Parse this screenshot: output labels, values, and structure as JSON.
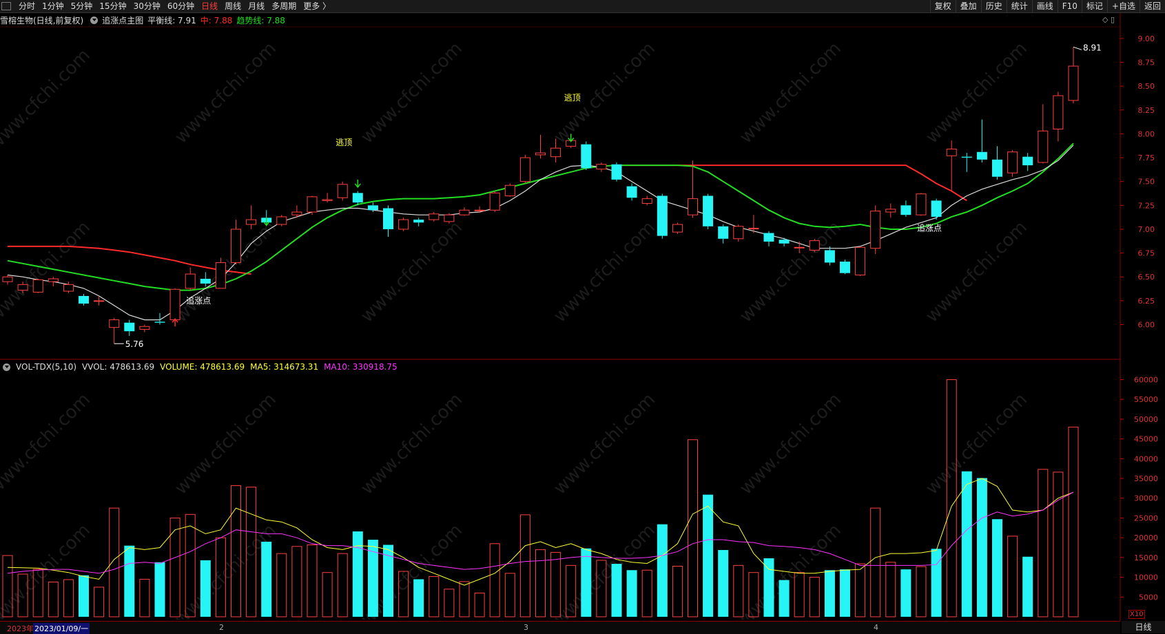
{
  "toolbar": {
    "timeframes": [
      {
        "label": "分时",
        "active": false
      },
      {
        "label": "1分钟",
        "active": false
      },
      {
        "label": "5分钟",
        "active": false
      },
      {
        "label": "15分钟",
        "active": false
      },
      {
        "label": "30分钟",
        "active": false
      },
      {
        "label": "60分钟",
        "active": false
      },
      {
        "label": "日线",
        "active": true
      },
      {
        "label": "周线",
        "active": false
      },
      {
        "label": "月线",
        "active": false
      },
      {
        "label": "多周期",
        "active": false
      },
      {
        "label": "更多 〉",
        "active": false
      }
    ],
    "right_buttons": [
      "复权",
      "叠加",
      "历史",
      "统计",
      "画线",
      "F10",
      "标记",
      "+自选",
      "返回"
    ]
  },
  "info": {
    "stock": "雪榕生物(日线,前复权)",
    "indicator": "追涨点主图",
    "balance_label": "平衡线: 7.91",
    "mid_label": "中: 7.88",
    "trend_label": "趋势线: 7.88",
    "colors": {
      "balance": "#dddddd",
      "mid": "#ff2a2a",
      "trend": "#22dd22"
    }
  },
  "volume_info": {
    "name": "VOL-TDX(5,10)",
    "vvol": "VVOL: 478613.69",
    "volume": "VOLUME: 478613.69",
    "ma5": "MA5: 314673.31",
    "ma10": "MA10: 330918.75",
    "colors": {
      "volume": "#ffff33",
      "ma5": "#ffff33",
      "ma10": "#ff33ff"
    }
  },
  "price_axis": [
    "9.00",
    "8.75",
    "8.50",
    "8.25",
    "8.00",
    "7.75",
    "7.50",
    "7.25",
    "7.00",
    "6.75",
    "6.50",
    "6.25",
    "6.00"
  ],
  "volume_axis": [
    "60000",
    "55000",
    "50000",
    "45000",
    "40000",
    "35000",
    "30000",
    "25000",
    "20000",
    "15000",
    "10000",
    "5000"
  ],
  "date_bar": {
    "year": "2023年",
    "current": "2023/01/09/一",
    "months": [
      "2",
      "3",
      "4"
    ]
  },
  "axis_mode": "日线",
  "x10_badge": "X10",
  "annotations": {
    "max_label": "8.91",
    "min_label": "5.76",
    "escape_top": "逃顶",
    "chase_point": "追涨点"
  },
  "watermark": "www.cfchi.com",
  "chart_data": {
    "type": "candlestick",
    "price_range": [
      5.76,
      9.05
    ],
    "volume_range": [
      0,
      62000
    ],
    "candles": [
      {
        "o": 6.45,
        "c": 6.5,
        "h": 6.52,
        "l": 6.42,
        "v": 15500
      },
      {
        "o": 6.36,
        "c": 6.42,
        "h": 6.45,
        "l": 6.33,
        "v": 10800
      },
      {
        "o": 6.34,
        "c": 6.47,
        "h": 6.48,
        "l": 6.33,
        "v": 12000
      },
      {
        "o": 6.45,
        "c": 6.48,
        "h": 6.5,
        "l": 6.4,
        "v": 8800
      },
      {
        "o": 6.35,
        "c": 6.42,
        "h": 6.45,
        "l": 6.33,
        "v": 9400
      },
      {
        "o": 6.3,
        "c": 6.22,
        "h": 6.32,
        "l": 6.2,
        "v": 10500
      },
      {
        "o": 6.25,
        "c": 6.25,
        "h": 6.3,
        "l": 6.2,
        "v": 7500
      },
      {
        "o": 5.97,
        "c": 6.05,
        "h": 6.07,
        "l": 5.8,
        "v": 27500
      },
      {
        "o": 6.02,
        "c": 5.93,
        "h": 6.05,
        "l": 5.88,
        "v": 18000
      },
      {
        "o": 5.95,
        "c": 5.98,
        "h": 6.0,
        "l": 5.92,
        "v": 9500
      },
      {
        "o": 6.03,
        "c": 6.02,
        "h": 6.12,
        "l": 6.0,
        "v": 13800
      },
      {
        "o": 6.05,
        "c": 6.37,
        "h": 6.38,
        "l": 6.05,
        "v": 25000
      },
      {
        "o": 6.38,
        "c": 6.53,
        "h": 6.6,
        "l": 6.36,
        "v": 25900
      },
      {
        "o": 6.48,
        "c": 6.43,
        "h": 6.55,
        "l": 6.4,
        "v": 14300
      },
      {
        "o": 6.38,
        "c": 6.65,
        "h": 6.7,
        "l": 6.38,
        "v": 20000
      },
      {
        "o": 6.65,
        "c": 7.0,
        "h": 7.1,
        "l": 6.63,
        "v": 33200
      },
      {
        "o": 7.05,
        "c": 7.1,
        "h": 7.25,
        "l": 7.0,
        "v": 32800
      },
      {
        "o": 7.12,
        "c": 7.07,
        "h": 7.2,
        "l": 7.05,
        "v": 19000
      },
      {
        "o": 7.05,
        "c": 7.13,
        "h": 7.15,
        "l": 7.03,
        "v": 16000
      },
      {
        "o": 7.15,
        "c": 7.18,
        "h": 7.25,
        "l": 7.12,
        "v": 17800
      },
      {
        "o": 7.18,
        "c": 7.34,
        "h": 7.35,
        "l": 7.15,
        "v": 18200
      },
      {
        "o": 7.3,
        "c": 7.31,
        "h": 7.38,
        "l": 7.28,
        "v": 11200
      },
      {
        "o": 7.33,
        "c": 7.47,
        "h": 7.5,
        "l": 7.3,
        "v": 16000
      },
      {
        "o": 7.38,
        "c": 7.28,
        "h": 7.4,
        "l": 7.25,
        "v": 21600
      },
      {
        "o": 7.25,
        "c": 7.2,
        "h": 7.28,
        "l": 7.18,
        "v": 19500
      },
      {
        "o": 7.22,
        "c": 7.0,
        "h": 7.25,
        "l": 6.92,
        "v": 18200
      },
      {
        "o": 7.0,
        "c": 7.1,
        "h": 7.12,
        "l": 6.98,
        "v": 11500
      },
      {
        "o": 7.1,
        "c": 7.07,
        "h": 7.12,
        "l": 7.03,
        "v": 9500
      },
      {
        "o": 7.1,
        "c": 7.16,
        "h": 7.18,
        "l": 7.08,
        "v": 10200
      },
      {
        "o": 7.08,
        "c": 7.15,
        "h": 7.17,
        "l": 7.06,
        "v": 7000
      },
      {
        "o": 7.15,
        "c": 7.2,
        "h": 7.23,
        "l": 7.14,
        "v": 8900
      },
      {
        "o": 7.2,
        "c": 7.2,
        "h": 7.24,
        "l": 7.17,
        "v": 6000
      },
      {
        "o": 7.2,
        "c": 7.38,
        "h": 7.4,
        "l": 7.18,
        "v": 18500
      },
      {
        "o": 7.35,
        "c": 7.46,
        "h": 7.48,
        "l": 7.34,
        "v": 11000
      },
      {
        "o": 7.5,
        "c": 7.75,
        "h": 7.78,
        "l": 7.48,
        "v": 25800
      },
      {
        "o": 7.78,
        "c": 7.8,
        "h": 7.99,
        "l": 7.74,
        "v": 17000
      },
      {
        "o": 7.76,
        "c": 7.85,
        "h": 7.95,
        "l": 7.7,
        "v": 16300
      },
      {
        "o": 7.87,
        "c": 7.93,
        "h": 7.98,
        "l": 7.85,
        "v": 13000
      },
      {
        "o": 7.89,
        "c": 7.64,
        "h": 7.92,
        "l": 7.62,
        "v": 17300
      },
      {
        "o": 7.63,
        "c": 7.68,
        "h": 7.7,
        "l": 7.6,
        "v": 14300
      },
      {
        "o": 7.68,
        "c": 7.52,
        "h": 7.7,
        "l": 7.5,
        "v": 13400
      },
      {
        "o": 7.45,
        "c": 7.33,
        "h": 7.48,
        "l": 7.3,
        "v": 11800
      },
      {
        "o": 7.27,
        "c": 7.32,
        "h": 7.35,
        "l": 7.25,
        "v": 11800
      },
      {
        "o": 7.35,
        "c": 6.93,
        "h": 7.37,
        "l": 6.9,
        "v": 23400
      },
      {
        "o": 6.97,
        "c": 7.05,
        "h": 7.07,
        "l": 6.95,
        "v": 12800
      },
      {
        "o": 7.15,
        "c": 7.32,
        "h": 7.72,
        "l": 7.12,
        "v": 44800
      },
      {
        "o": 7.35,
        "c": 7.03,
        "h": 7.37,
        "l": 7.0,
        "v": 30900
      },
      {
        "o": 7.03,
        "c": 6.9,
        "h": 7.05,
        "l": 6.85,
        "v": 16900
      },
      {
        "o": 6.9,
        "c": 7.03,
        "h": 7.05,
        "l": 6.87,
        "v": 13000
      },
      {
        "o": 7.01,
        "c": 7.01,
        "h": 7.15,
        "l": 6.96,
        "v": 11200
      },
      {
        "o": 6.96,
        "c": 6.87,
        "h": 6.98,
        "l": 6.82,
        "v": 14800
      },
      {
        "o": 6.89,
        "c": 6.85,
        "h": 6.91,
        "l": 6.82,
        "v": 9300
      },
      {
        "o": 6.81,
        "c": 6.81,
        "h": 6.87,
        "l": 6.75,
        "v": 11200
      },
      {
        "o": 6.78,
        "c": 6.88,
        "h": 6.9,
        "l": 6.76,
        "v": 10000
      },
      {
        "o": 6.78,
        "c": 6.65,
        "h": 6.82,
        "l": 6.62,
        "v": 11800
      },
      {
        "o": 6.66,
        "c": 6.54,
        "h": 6.68,
        "l": 6.53,
        "v": 12000
      },
      {
        "o": 6.52,
        "c": 6.81,
        "h": 6.82,
        "l": 6.51,
        "v": 13400
      },
      {
        "o": 6.8,
        "c": 7.19,
        "h": 7.25,
        "l": 6.74,
        "v": 27500
      },
      {
        "o": 7.18,
        "c": 7.21,
        "h": 7.27,
        "l": 7.12,
        "v": 13800
      },
      {
        "o": 7.25,
        "c": 7.15,
        "h": 7.3,
        "l": 7.13,
        "v": 12000
      },
      {
        "o": 7.15,
        "c": 7.37,
        "h": 7.38,
        "l": 7.14,
        "v": 12700
      },
      {
        "o": 7.3,
        "c": 7.13,
        "h": 7.32,
        "l": 7.1,
        "v": 17200
      },
      {
        "o": 7.77,
        "c": 7.84,
        "h": 7.93,
        "l": 7.4,
        "v": 60000
      },
      {
        "o": 7.76,
        "c": 7.75,
        "h": 7.8,
        "l": 7.6,
        "v": 36800
      },
      {
        "o": 7.81,
        "c": 7.73,
        "h": 8.15,
        "l": 7.7,
        "v": 35100
      },
      {
        "o": 7.73,
        "c": 7.55,
        "h": 7.87,
        "l": 7.52,
        "v": 24700
      },
      {
        "o": 7.59,
        "c": 7.81,
        "h": 7.83,
        "l": 7.55,
        "v": 20400
      },
      {
        "o": 7.76,
        "c": 7.67,
        "h": 7.8,
        "l": 7.61,
        "v": 15200
      },
      {
        "o": 7.7,
        "c": 8.03,
        "h": 8.31,
        "l": 7.69,
        "v": 37300
      },
      {
        "o": 8.05,
        "c": 8.4,
        "h": 8.44,
        "l": 7.92,
        "v": 36600
      },
      {
        "o": 8.35,
        "c": 8.71,
        "h": 8.91,
        "l": 8.32,
        "v": 48000
      }
    ],
    "balance_line": [
      6.52,
      6.5,
      6.47,
      6.45,
      6.42,
      6.38,
      6.3,
      6.2,
      6.1,
      6.05,
      6.05,
      6.15,
      6.28,
      6.38,
      6.48,
      6.65,
      6.85,
      6.98,
      7.08,
      7.13,
      7.18,
      7.2,
      7.22,
      7.22,
      7.2,
      7.18,
      7.16,
      7.15,
      7.15,
      7.15,
      7.17,
      7.18,
      7.22,
      7.3,
      7.4,
      7.52,
      7.6,
      7.66,
      7.67,
      7.65,
      7.6,
      7.5,
      7.4,
      7.3,
      7.25,
      7.2,
      7.15,
      7.08,
      7.02,
      6.98,
      6.94,
      6.9,
      6.85,
      6.8,
      6.8,
      6.8,
      6.82,
      6.88,
      6.95,
      7.02,
      7.07,
      7.12,
      7.25,
      7.35,
      7.42,
      7.47,
      7.52,
      7.56,
      7.62,
      7.72,
      7.88
    ],
    "mid_line": [
      6.82,
      6.82,
      6.82,
      6.82,
      6.82,
      6.81,
      6.8,
      6.78,
      6.76,
      6.73,
      6.7,
      6.67,
      6.63,
      6.6,
      6.57,
      6.55,
      6.53,
      null,
      null,
      null,
      null,
      null,
      null,
      null,
      null,
      null,
      null,
      null,
      null,
      null,
      null,
      null,
      null,
      null,
      null,
      null,
      null,
      null,
      null,
      null,
      7.67,
      7.67,
      7.67,
      7.67,
      7.67,
      7.67,
      7.67,
      7.67,
      7.67,
      7.67,
      7.67,
      7.67,
      7.67,
      7.67,
      7.67,
      7.67,
      7.67,
      7.67,
      7.67,
      7.67,
      7.58,
      7.48,
      7.4,
      7.3,
      null,
      null,
      null,
      null,
      null,
      null,
      null
    ],
    "trend_line": [
      6.67,
      6.64,
      6.61,
      6.58,
      6.55,
      6.52,
      6.49,
      6.46,
      6.43,
      6.4,
      6.38,
      6.36,
      6.36,
      6.38,
      6.42,
      6.48,
      6.56,
      6.66,
      6.78,
      6.9,
      7.02,
      7.12,
      7.2,
      7.26,
      7.29,
      7.31,
      7.32,
      7.32,
      7.32,
      7.33,
      7.34,
      7.36,
      7.4,
      7.44,
      7.48,
      7.52,
      7.56,
      7.6,
      7.64,
      7.66,
      7.67,
      7.67,
      7.67,
      7.67,
      7.67,
      7.66,
      7.6,
      7.5,
      7.4,
      7.3,
      7.2,
      7.12,
      7.06,
      7.03,
      7.02,
      7.03,
      7.05,
      7.02,
      7.0,
      7.0,
      7.02,
      7.06,
      7.13,
      7.18,
      7.25,
      7.33,
      7.4,
      7.48,
      7.6,
      7.74,
      7.9
    ],
    "ma5": [
      12500,
      12400,
      12300,
      11800,
      11200,
      10200,
      9500,
      14500,
      17500,
      17000,
      17500,
      22000,
      23000,
      21000,
      22000,
      27500,
      26000,
      24500,
      24000,
      22500,
      19500,
      17500,
      17000,
      18000,
      17800,
      17000,
      15000,
      12500,
      11000,
      9500,
      8000,
      9500,
      11000,
      14000,
      18000,
      19000,
      17500,
      18500,
      17000,
      16000,
      14500,
      13800,
      13500,
      15500,
      18500,
      26000,
      28000,
      24000,
      23000,
      16000,
      12000,
      11500,
      11000,
      11000,
      11500,
      11800,
      12000,
      15000,
      16000,
      16000,
      16200,
      16800,
      28000,
      33500,
      35000,
      33000,
      27000,
      26500,
      27000,
      30000,
      31500
    ],
    "ma10": [
      11000,
      11500,
      11800,
      12000,
      12000,
      11500,
      11000,
      12000,
      13500,
      13800,
      13500,
      15000,
      16500,
      18500,
      20000,
      22000,
      21500,
      21000,
      21000,
      20000,
      18500,
      18000,
      18000,
      17500,
      16500,
      15500,
      14500,
      13500,
      13000,
      12500,
      12000,
      12200,
      12800,
      13500,
      14000,
      14200,
      14500,
      15000,
      15300,
      15000,
      14800,
      14800,
      15000,
      15500,
      16500,
      18500,
      19500,
      19500,
      19000,
      18800,
      18000,
      17800,
      17500,
      17000,
      16000,
      14500,
      13000,
      13000,
      13000,
      13000,
      13000,
      13200,
      18000,
      22000,
      25000,
      26500,
      25500,
      26000,
      27000,
      29500,
      31500
    ]
  }
}
